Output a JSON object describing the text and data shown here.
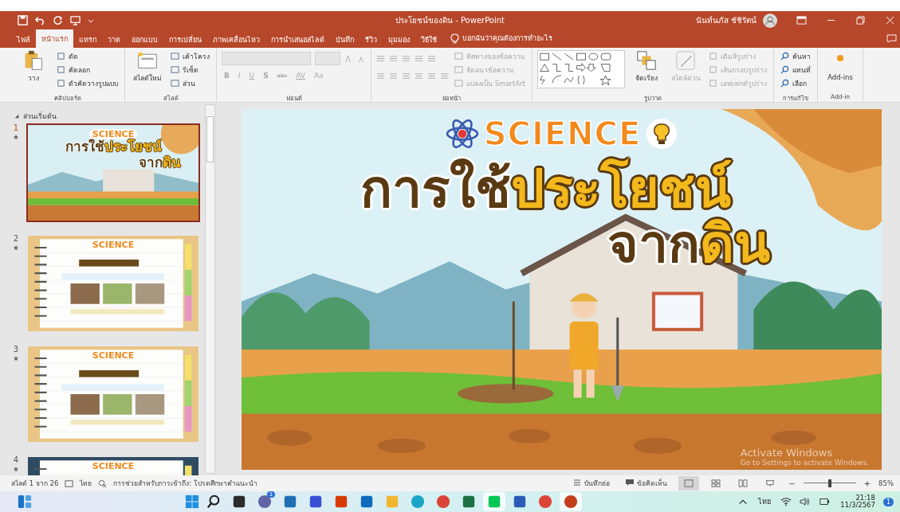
{
  "window": {
    "title": "ประโยชน์ของดิน - PowerPoint",
    "user": "นันท์นภัส ชัชิรัตน์"
  },
  "tabs": [
    {
      "label": "ไฟล์",
      "selected": false
    },
    {
      "label": "หน้าแรก",
      "selected": true
    },
    {
      "label": "แทรก",
      "selected": false
    },
    {
      "label": "วาด",
      "selected": false
    },
    {
      "label": "ออกแบบ",
      "selected": false
    },
    {
      "label": "การเปลี่ยน",
      "selected": false
    },
    {
      "label": "ภาพเคลื่อนไหว",
      "selected": false
    },
    {
      "label": "การนำเสนอสไลด์",
      "selected": false
    },
    {
      "label": "บันทึก",
      "selected": false
    },
    {
      "label": "รีวิว",
      "selected": false
    },
    {
      "label": "มุมมอง",
      "selected": false
    },
    {
      "label": "วิธีใช้",
      "selected": false
    }
  ],
  "tell_me": "บอกฉันว่าคุณต้องการทำอะไร",
  "ribbon": [
    {
      "kind": "clipboard",
      "label": "คลิปบอร์ด",
      "main": "วาง",
      "items": [
        "ตัด",
        "คัดลอก",
        "ตัวคัดวางรูปแบบ"
      ]
    },
    {
      "kind": "slides",
      "label": "สไลด์",
      "main": "สไลด์ใหม่",
      "items": [
        "เค้าโครง",
        "รีเซ็ต",
        "ส่วน"
      ]
    },
    {
      "kind": "font",
      "label": "ฟอนต์",
      "disabled": true,
      "items": [
        "B",
        "I",
        "U",
        "S",
        "abc",
        "AV",
        "Aa"
      ]
    },
    {
      "kind": "paragraph",
      "label": "ย่อหน้า",
      "disabled": true,
      "items": [
        "ทิศทางของข้อความ",
        "จัดแนวข้อความ",
        "แปลงเป็น SmartArt"
      ]
    },
    {
      "kind": "drawing",
      "label": "รูปวาด",
      "main": "จัดเรียง",
      "secondary": "สไตล์ด่วน",
      "disabled": true,
      "items": [
        "เติมสีรูปร่าง",
        "เส้นกรอบรูปร่าง",
        "เอฟเฟกต์รูปร่าง"
      ]
    },
    {
      "kind": "editing",
      "label": "การแก้ไข",
      "items": [
        "ค้นหา",
        "แทนที่",
        "เลือก"
      ]
    },
    {
      "kind": "addins",
      "label": "Add-in",
      "main": "Add-ins"
    }
  ],
  "outline": {
    "section": "ส่วนเริ่มต้น",
    "slides": [
      {
        "number": "1",
        "selected": true,
        "kind": "title",
        "logo": "SCIENCE",
        "title_lines": [
          [
            {
              "text": "การใช้",
              "highlight": false
            },
            {
              "text": "ประโยชน์",
              "highlight": true
            }
          ],
          [
            {
              "text": "จาก",
              "highlight": false
            },
            {
              "text": "ดิน",
              "highlight": true
            }
          ]
        ]
      },
      {
        "number": "2",
        "selected": false,
        "kind": "notebook",
        "logo": "SCIENCE"
      },
      {
        "number": "3",
        "selected": false,
        "kind": "notebook",
        "logo": "SCIENCE"
      },
      {
        "number": "4",
        "selected": false,
        "kind": "dark",
        "logo": "SCIENCE"
      }
    ]
  },
  "slide": {
    "logo": "SCIENCE",
    "title_lines": [
      [
        {
          "text": "การใช้",
          "highlight": false
        },
        {
          "text": "ประโยชน์",
          "highlight": true
        }
      ],
      [
        {
          "text": "จาก",
          "highlight": false
        },
        {
          "text": "ดิน",
          "highlight": true
        }
      ]
    ]
  },
  "activation": {
    "title": "Activate Windows",
    "hint": "Go to Settings to activate Windows."
  },
  "status_bar": {
    "slide_count": "สไลด์ 1 จาก 26",
    "language": "ไทย",
    "accessibility": "การช่วยสำหรับการเข้าถึง: โปรดศึกษาคำแนะนำ",
    "notes": "บันทึกย่อ",
    "comments": "ข้อคิดเห็น",
    "views": [
      {
        "kind": "normal",
        "selected": true
      },
      {
        "kind": "sorter",
        "selected": false
      },
      {
        "kind": "reading",
        "selected": false
      },
      {
        "kind": "slideshow",
        "selected": false
      }
    ],
    "zoom": {
      "minus": "−",
      "plus": "+",
      "level": 0.5,
      "reading": "85%"
    }
  },
  "taskbar": {
    "apps": [
      {
        "kind": "search",
        "active": false
      },
      {
        "kind": "taskview",
        "active": false
      },
      {
        "kind": "chat",
        "active": false,
        "badge": "1"
      },
      {
        "kind": "store",
        "active": false
      },
      {
        "kind": "tool",
        "active": false
      },
      {
        "kind": "office",
        "active": false
      },
      {
        "kind": "mail",
        "active": false
      },
      {
        "kind": "folder",
        "active": false
      },
      {
        "kind": "edge",
        "active": false
      },
      {
        "kind": "chrome",
        "active": false
      },
      {
        "kind": "excel",
        "active": false
      },
      {
        "kind": "line",
        "active": true
      },
      {
        "kind": "word",
        "active": false
      },
      {
        "kind": "chrome",
        "active": false
      },
      {
        "kind": "powerpoint",
        "active": true
      }
    ],
    "language": "ไทย",
    "time": "21:18",
    "date": "11/3/2567",
    "notifications": "1"
  }
}
